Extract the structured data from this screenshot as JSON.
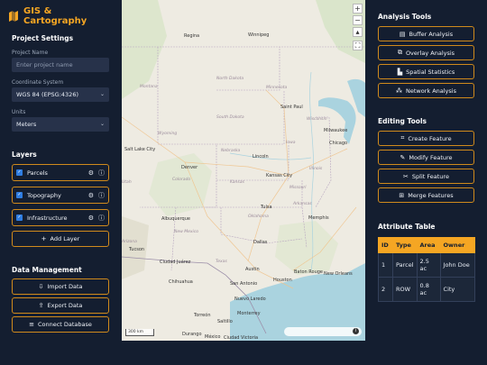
{
  "app": {
    "title": "GIS & Cartography"
  },
  "project_settings": {
    "title": "Project Settings",
    "name_label": "Project Name",
    "name_placeholder": "Enter project name",
    "crs_label": "Coordinate System",
    "crs_value": "WGS 84 (EPSG:4326)",
    "units_label": "Units",
    "units_value": "Meters"
  },
  "layers": {
    "title": "Layers",
    "items": [
      {
        "label": "Parcels",
        "checked": true
      },
      {
        "label": "Topography",
        "checked": true
      },
      {
        "label": "Infrastructure",
        "checked": true
      }
    ],
    "add_label": "Add Layer"
  },
  "data_management": {
    "title": "Data Management",
    "import_label": "Import Data",
    "export_label": "Export Data",
    "connect_label": "Connect Database"
  },
  "map": {
    "zoom_in": "+",
    "zoom_out": "−",
    "scale_label": "300 km",
    "labels": {
      "regina": "Regina",
      "winnipeg": "Winnipeg",
      "north_dakota": "North Dakota",
      "minnesota": "Minnesota",
      "montana": "Montana",
      "saint_paul": "Saint Paul",
      "south_dakota": "South Dakota",
      "wisconsin": "Wisconsin",
      "wyoming": "Wyoming",
      "milwaukee": "Milwaukee",
      "chicago": "Chicago",
      "iowa": "Iowa",
      "nebraska": "Nebraska",
      "lincoln": "Lincoln",
      "salt_lake_city": "Salt Lake City",
      "illinois": "Illinois",
      "denver": "Denver",
      "kansas_city": "Kansas City",
      "colorado": "Colorado",
      "kansas": "Kansas",
      "missouri": "Missouri",
      "tulsa": "Tulsa",
      "albuquerque": "Albuquerque",
      "oklahoma": "Oklahoma",
      "memphis": "Memphis",
      "new_mexico": "New Mexico",
      "arizona": "Arizona",
      "dallas": "Dallas",
      "tucson": "Tucson",
      "ciudad_juarez": "Ciudad Juárez",
      "texas": "Texas",
      "austin": "Austin",
      "baton_rouge": "Baton Rouge",
      "new_orleans": "New Orleans",
      "chihuahua": "Chihuahua",
      "san_antonio": "San Antonio",
      "houston": "Houston",
      "nuevo_laredo": "Nuevo Laredo",
      "torreon": "Torreón",
      "monterrey": "Monterrey",
      "saltillo": "Saltillo",
      "durango": "Durango",
      "mexico": "México",
      "ciudad_victoria": "Ciudad Victoria",
      "arkansas": "Arkansas",
      "utah": "Utah"
    }
  },
  "analysis_tools": {
    "title": "Analysis Tools",
    "items": [
      {
        "label": "Buffer Analysis",
        "icon": "buffer-icon"
      },
      {
        "label": "Overlay Analysis",
        "icon": "overlay-icon"
      },
      {
        "label": "Spatial Statistics",
        "icon": "chart-icon"
      },
      {
        "label": "Network Analysis",
        "icon": "network-icon"
      }
    ]
  },
  "editing_tools": {
    "title": "Editing Tools",
    "items": [
      {
        "label": "Create Feature",
        "icon": "create-icon"
      },
      {
        "label": "Modify Feature",
        "icon": "edit-icon"
      },
      {
        "label": "Split Feature",
        "icon": "split-icon"
      },
      {
        "label": "Merge Features",
        "icon": "merge-icon"
      }
    ]
  },
  "attribute_table": {
    "title": "Attribute Table",
    "columns": [
      "ID",
      "Type",
      "Area",
      "Owner"
    ],
    "rows": [
      [
        "1",
        "Parcel",
        "2.5 ac",
        "John Doe"
      ],
      [
        "2",
        "ROW",
        "0.8 ac",
        "City"
      ]
    ]
  },
  "colors": {
    "accent": "#f5a623",
    "background": "#141e30",
    "border": "#d08a1c",
    "checkbox": "#2f7de1"
  }
}
